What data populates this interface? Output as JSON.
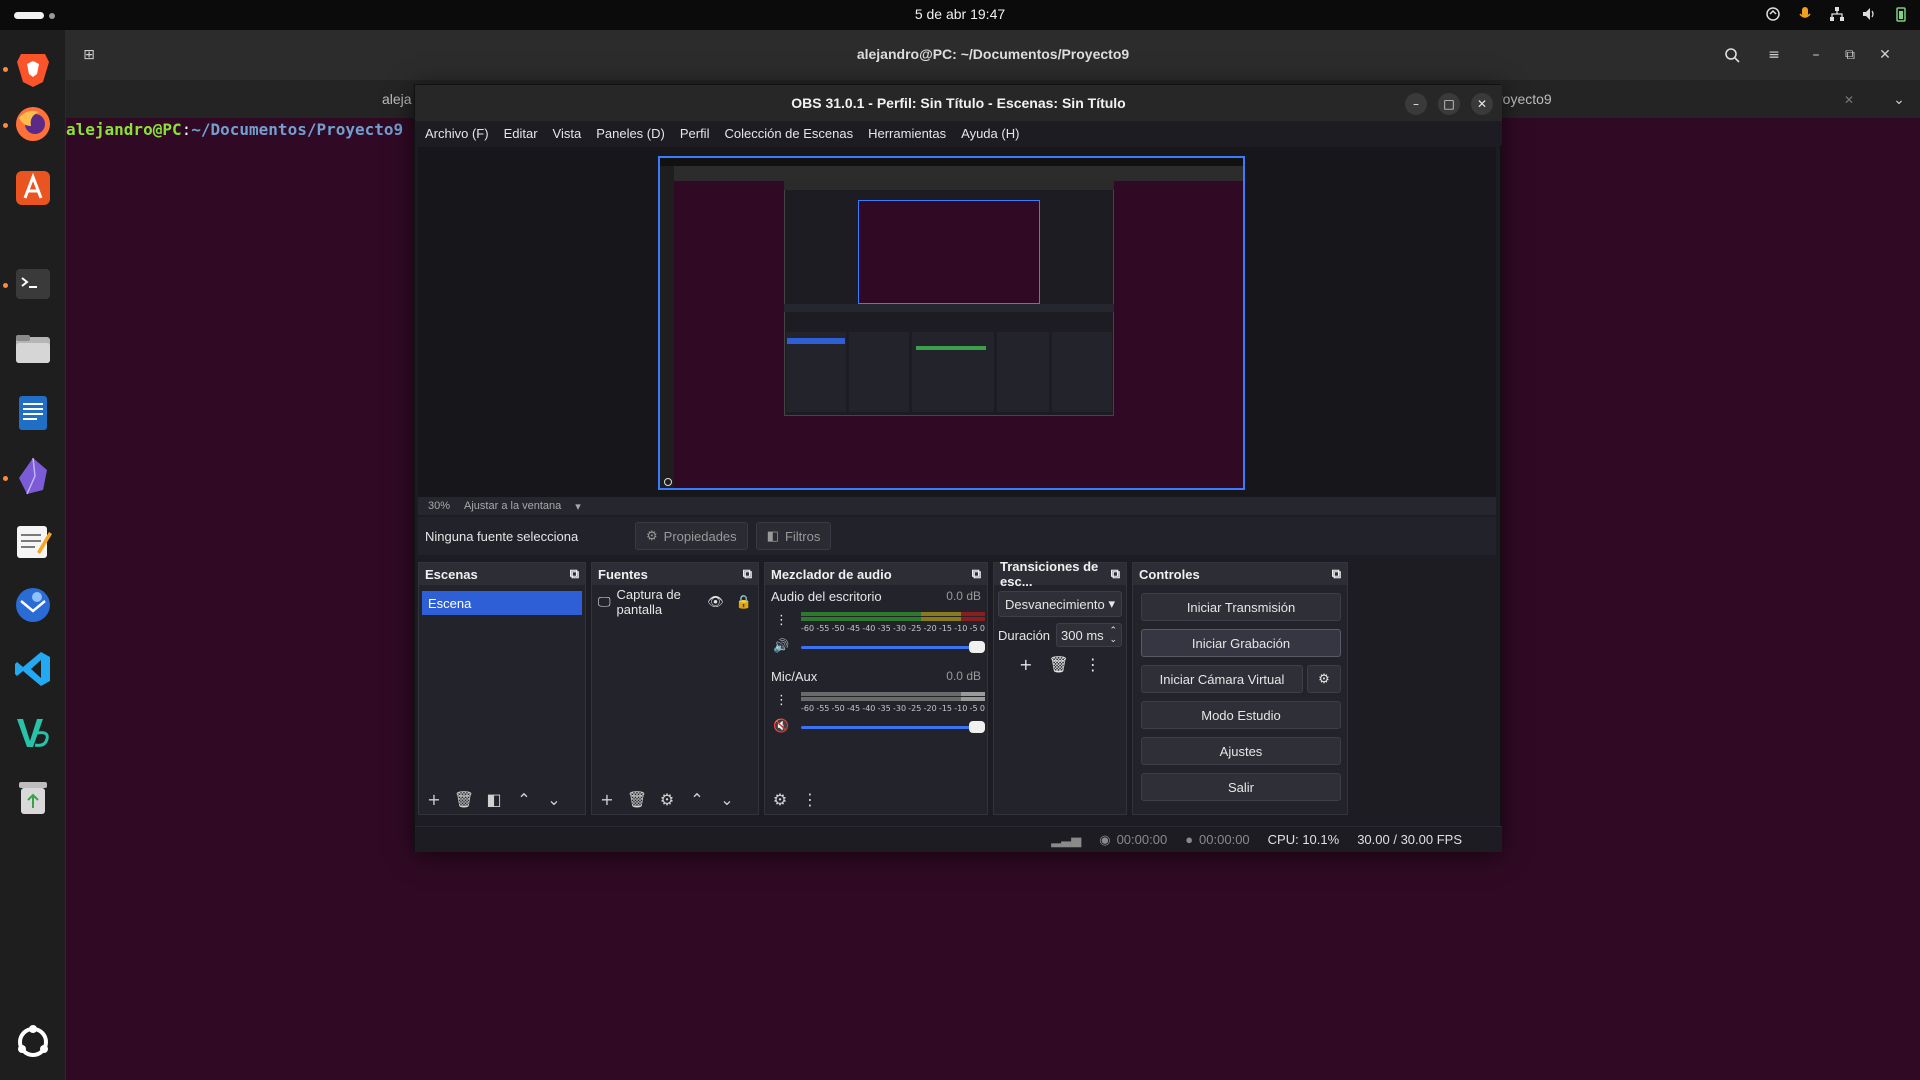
{
  "system": {
    "clock": "5 de abr  19:47"
  },
  "terminal": {
    "title": "alejandro@PC: ~/Documentos/Proyecto9",
    "tab_left": "aleja",
    "tab_right": "royecto9",
    "prompt_user": "alejandro@PC",
    "prompt_sep": ":",
    "prompt_path": "~/Documentos/Proyecto9"
  },
  "dock": {
    "items": [
      "brave-browser",
      "firefox",
      "app-center",
      "terminal",
      "files",
      "writer",
      "obsidian",
      "text-editor",
      "thunderbird",
      "vscode",
      "visual-studio-alt",
      "trash",
      "ubuntu-apps"
    ]
  },
  "obs": {
    "title": "OBS 31.0.1 - Perfil: Sin Título - Escenas: Sin Título",
    "menu": [
      "Archivo (F)",
      "Editar",
      "Vista",
      "Paneles (D)",
      "Perfil",
      "Colección de Escenas",
      "Herramientas",
      "Ayuda (H)"
    ],
    "zoom": "30%",
    "fit_label": "Ajustar a la ventana",
    "no_source": "Ninguna fuente selecciona",
    "properties_btn": "Propiedades",
    "filters_btn": "Filtros",
    "scenes": {
      "title": "Escenas",
      "items": [
        "Escena"
      ]
    },
    "sources": {
      "title": "Fuentes",
      "items": [
        "Captura de pantalla"
      ]
    },
    "mixer": {
      "title": "Mezclador de audio",
      "channels": [
        {
          "name": "Audio del escritorio",
          "db": "0.0 dB",
          "volume": 1.0,
          "muted": false
        },
        {
          "name": "Mic/Aux",
          "db": "0.0 dB",
          "volume": 1.0,
          "muted": true
        }
      ],
      "ticks": [
        "-60",
        "-55",
        "-50",
        "-45",
        "-40",
        "-35",
        "-30",
        "-25",
        "-20",
        "-15",
        "-10",
        "-5",
        "0"
      ]
    },
    "transitions": {
      "title": "Transiciones de esc...",
      "selected": "Desvanecimiento",
      "duration_label": "Duración",
      "duration_value": "300 ms"
    },
    "controls": {
      "title": "Controles",
      "start_stream": "Iniciar Transmisión",
      "start_record": "Iniciar Grabación",
      "virtual_cam": "Iniciar Cámara Virtual",
      "studio_mode": "Modo Estudio",
      "settings": "Ajustes",
      "exit": "Salir"
    },
    "status": {
      "stream_time": "00:00:00",
      "record_time": "00:00:00",
      "cpu": "CPU: 10.1%",
      "fps": "30.00 / 30.00 FPS"
    }
  }
}
